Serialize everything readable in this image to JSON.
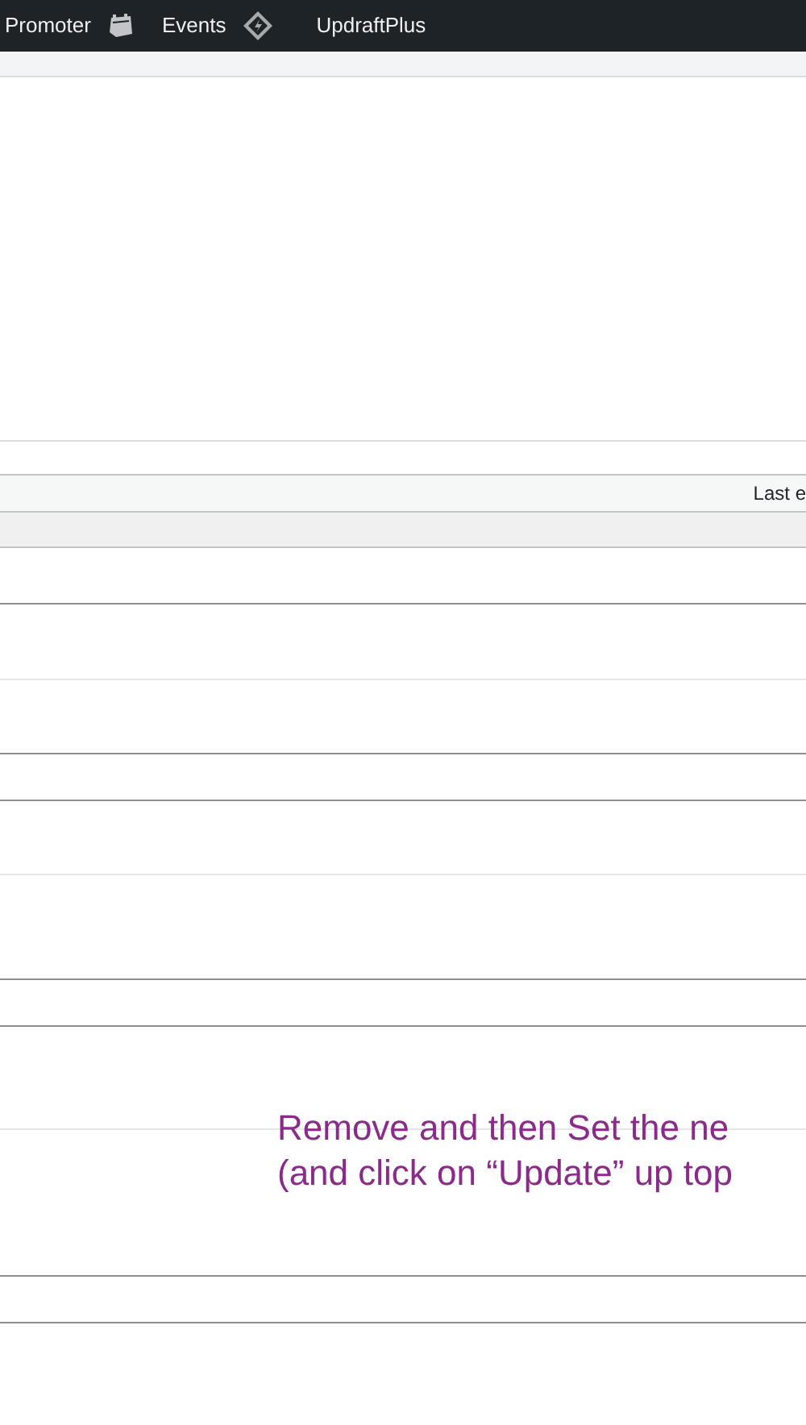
{
  "admin_bar": {
    "items": [
      {
        "label": "Promoter",
        "kind": "text"
      },
      {
        "label": "Events",
        "kind": "calendar"
      },
      {
        "label": "UpdraftPlus",
        "kind": "diamond"
      }
    ]
  },
  "table": {
    "columns": [
      "Last e"
    ]
  },
  "annotation": {
    "lines": [
      "Remove and then Set the ne",
      "(and click on “Update” up top"
    ]
  }
}
